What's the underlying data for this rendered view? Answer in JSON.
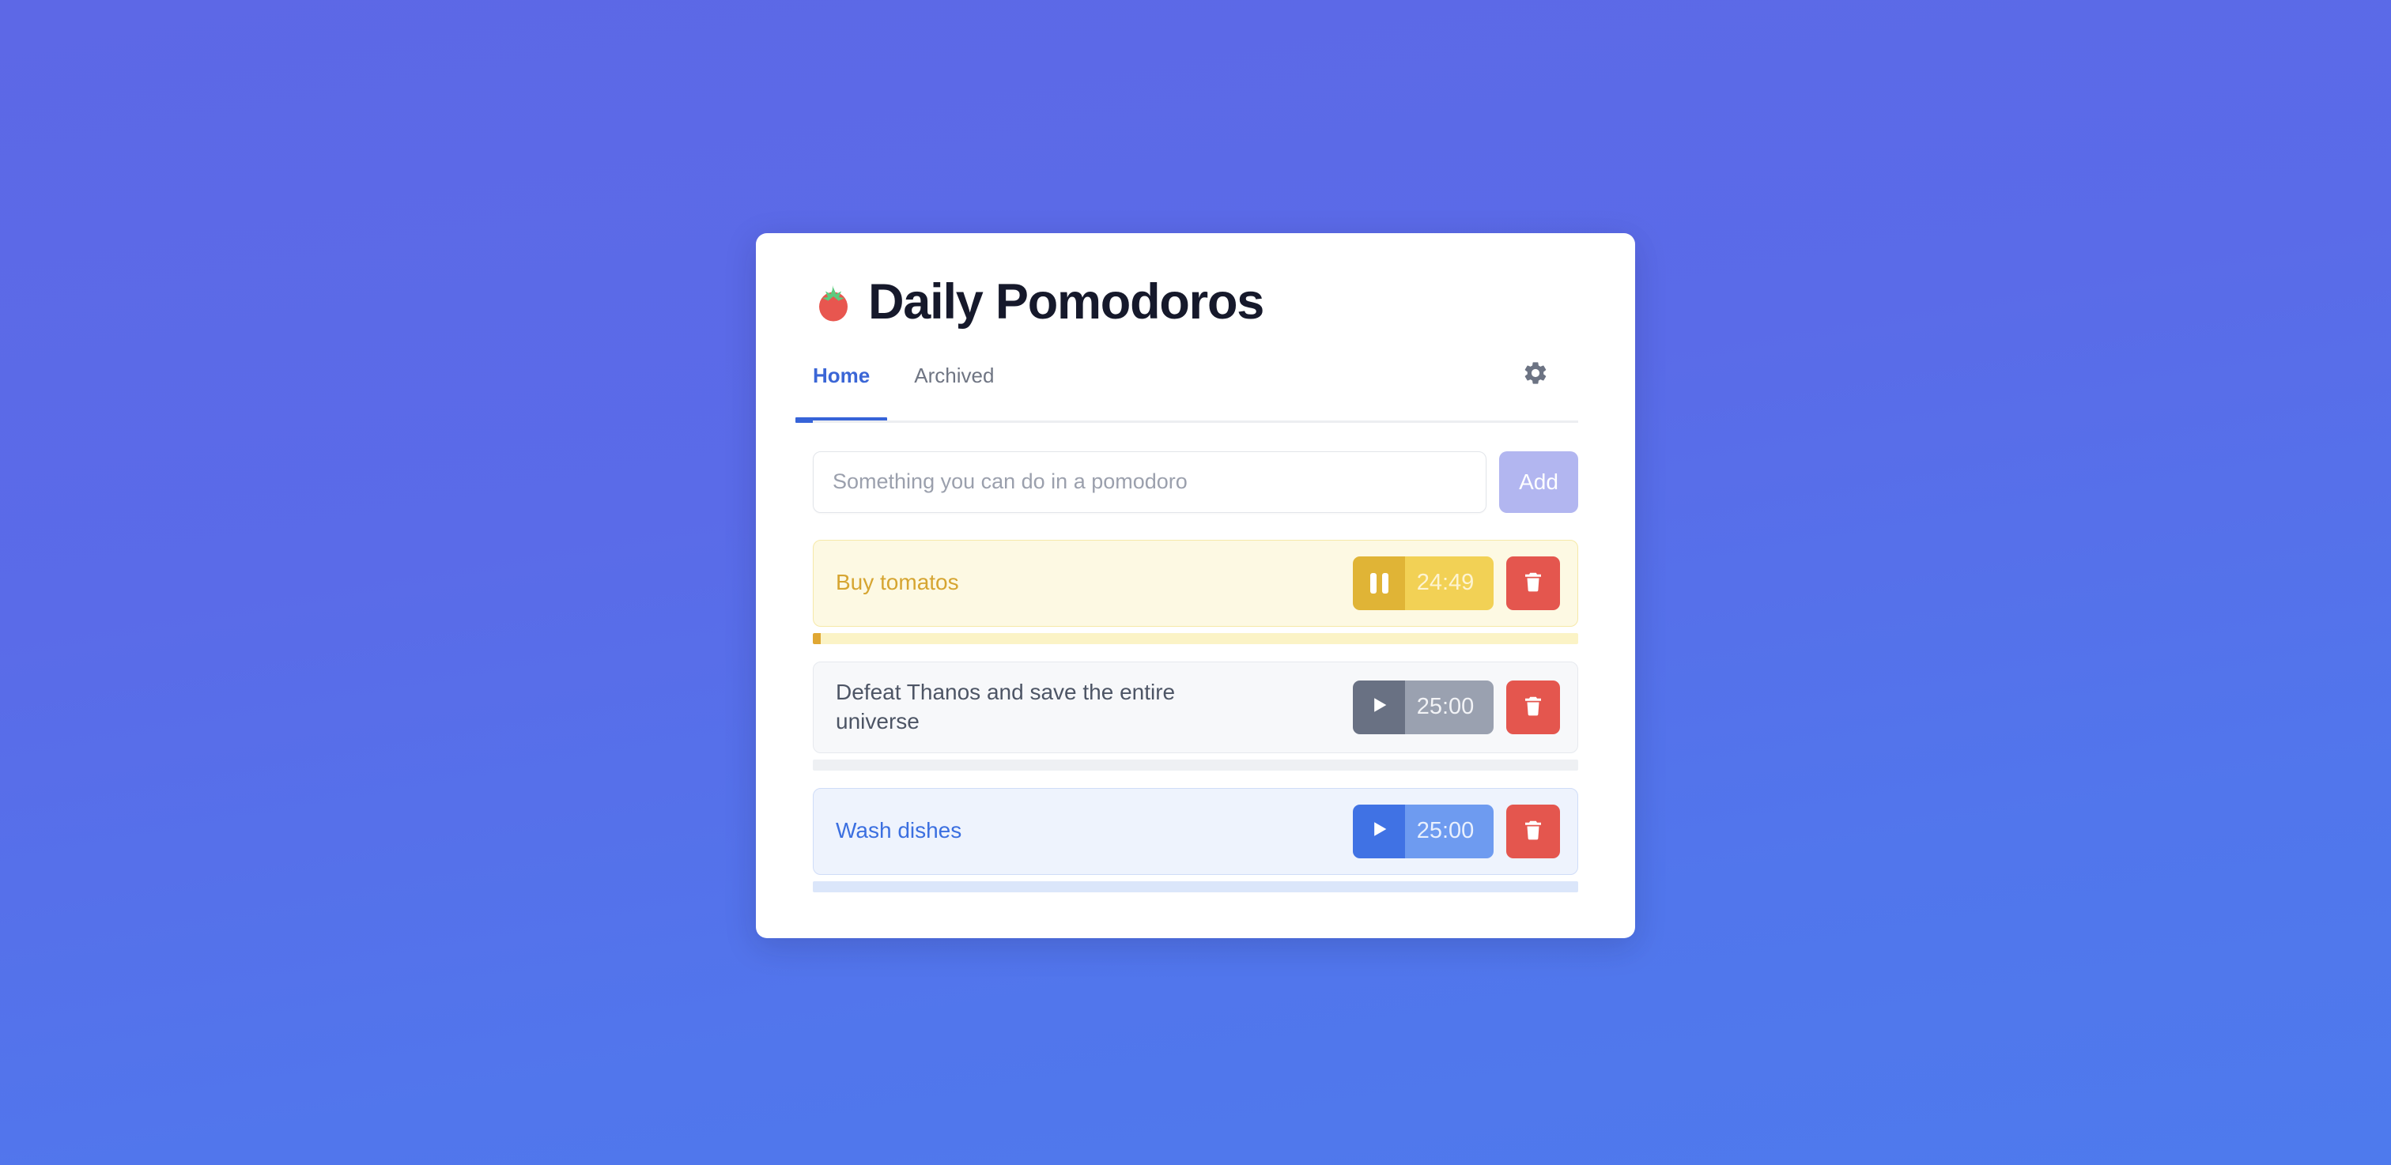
{
  "app": {
    "title": "Daily Pomodoros",
    "logo_icon": "tomato-icon"
  },
  "tabs": [
    {
      "label": "Home",
      "active": true
    },
    {
      "label": "Archived",
      "active": false
    }
  ],
  "settings": {
    "icon": "gear-icon"
  },
  "add_form": {
    "placeholder": "Something you can do in a pomodoro",
    "value": "",
    "button_label": "Add"
  },
  "tasks": [
    {
      "title": "Buy tomatos",
      "time": "24:49",
      "state": "running",
      "toggle_icon": "pause-icon",
      "delete_icon": "trash-icon",
      "theme": "amber",
      "progress_percent": 1
    },
    {
      "title": "Defeat Thanos and save the entire universe",
      "time": "25:00",
      "state": "idle",
      "toggle_icon": "play-icon",
      "delete_icon": "trash-icon",
      "theme": "gray",
      "progress_percent": 0
    },
    {
      "title": "Wash dishes",
      "time": "25:00",
      "state": "idle",
      "toggle_icon": "play-icon",
      "delete_icon": "trash-icon",
      "theme": "blue",
      "progress_percent": 0
    }
  ],
  "colors": {
    "background_top": "#5d68e6",
    "background_bottom": "#4e7aed",
    "accent_blue": "#3663d8",
    "add_button": "#b2b6f0",
    "delete_button": "#e4564e",
    "amber": "#e0b436",
    "gray": "#697183",
    "blue": "#4072e4"
  }
}
